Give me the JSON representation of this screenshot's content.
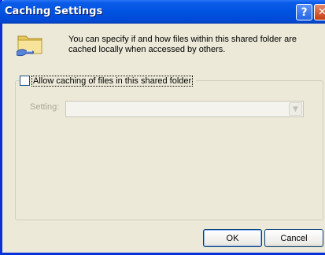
{
  "window": {
    "title": "Caching Settings",
    "help_label": "?",
    "close_label": "✕"
  },
  "header": {
    "description": "You can specify if and how files within this shared folder are cached locally when accessed by others."
  },
  "caching": {
    "allow_label": "Allow caching of files in this shared folder",
    "allow_checked": false,
    "setting_label": "Setting:",
    "setting_value": ""
  },
  "buttons": {
    "ok_label": "OK",
    "cancel_label": "Cancel"
  },
  "icons": {
    "header_icon": "shared-folder-icon",
    "dropdown_icon": "chevron-down-icon"
  }
}
